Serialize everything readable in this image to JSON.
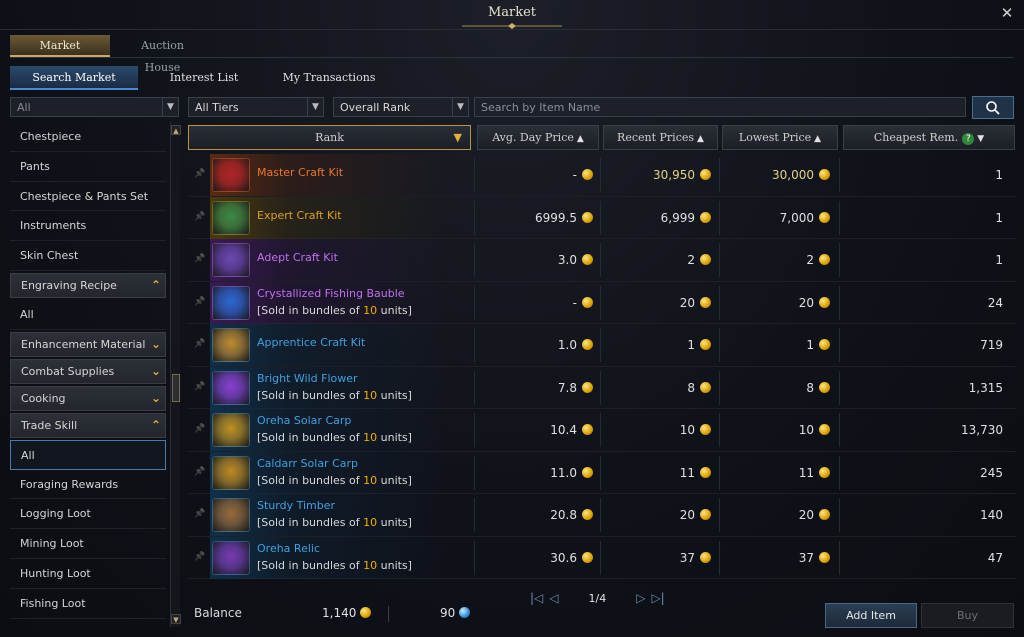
{
  "window": {
    "title": "Market"
  },
  "top_tabs": [
    "Market",
    "Auction House"
  ],
  "sub_tabs": [
    "Search Market",
    "Interest List",
    "My Transactions"
  ],
  "sidebar": {
    "filter_value": "All",
    "items": [
      {
        "label": "Chestpiece",
        "type": "item"
      },
      {
        "label": "Pants",
        "type": "item"
      },
      {
        "label": "Chestpiece & Pants Set",
        "type": "item"
      },
      {
        "label": "Instruments",
        "type": "item"
      },
      {
        "label": "Skin Chest",
        "type": "item"
      },
      {
        "label": "Engraving Recipe",
        "type": "cat-open"
      },
      {
        "label": "All",
        "type": "item"
      },
      {
        "label": "Enhancement Material",
        "type": "cat"
      },
      {
        "label": "Combat Supplies",
        "type": "cat"
      },
      {
        "label": "Cooking",
        "type": "cat"
      },
      {
        "label": "Trade Skill",
        "type": "cat-open"
      },
      {
        "label": "All",
        "type": "selected"
      },
      {
        "label": "Foraging Rewards",
        "type": "item"
      },
      {
        "label": "Logging Loot",
        "type": "item"
      },
      {
        "label": "Mining Loot",
        "type": "item"
      },
      {
        "label": "Hunting Loot",
        "type": "item"
      },
      {
        "label": "Fishing Loot",
        "type": "item"
      }
    ]
  },
  "filters": {
    "tier": "All Tiers",
    "rank": "Overall Rank",
    "search_placeholder": "Search by Item Name"
  },
  "columns": {
    "rank": "Rank",
    "avg": "Avg. Day Price",
    "recent": "Recent Prices",
    "lowest": "Lowest Price",
    "cheapest": "Cheapest Rem."
  },
  "items": [
    {
      "name": "Master Craft Kit",
      "name_color": "#e8762c",
      "tint": "#5a2a12",
      "bundle": null,
      "avg": "-",
      "recent": "30,950",
      "lowest": "30,000",
      "rem": "1",
      "gold": true,
      "icon_color": "#b0242a"
    },
    {
      "name": "Expert Craft Kit",
      "name_color": "#e0a020",
      "tint": "#4a3a10",
      "bundle": null,
      "avg": "6999.5",
      "recent": "6,999",
      "lowest": "7,000",
      "rem": "1",
      "gold": false,
      "icon_color": "#3a8a4a"
    },
    {
      "name": "Adept Craft Kit",
      "name_color": "#c070f0",
      "tint": "#3a1a52",
      "bundle": null,
      "avg": "3.0",
      "recent": "2",
      "lowest": "2",
      "rem": "1",
      "gold": false,
      "icon_color": "#6a4ab0"
    },
    {
      "name": "Crystallized Fishing Bauble",
      "name_color": "#c070f0",
      "tint": "#3a1a52",
      "bundle": "10",
      "avg": "-",
      "recent": "20",
      "lowest": "20",
      "rem": "24",
      "gold": false,
      "icon_color": "#2a6ad0"
    },
    {
      "name": "Apprentice Craft Kit",
      "name_color": "#3fa0e0",
      "tint": "#10304a",
      "bundle": null,
      "avg": "1.0",
      "recent": "1",
      "lowest": "1",
      "rem": "719",
      "gold": false,
      "icon_color": "#c08a30"
    },
    {
      "name": "Bright Wild Flower",
      "name_color": "#3fa0e0",
      "tint": "#10304a",
      "bundle": "10",
      "avg": "7.8",
      "recent": "8",
      "lowest": "8",
      "rem": "1,315",
      "gold": false,
      "icon_color": "#8a40d0"
    },
    {
      "name": "Oreha Solar Carp",
      "name_color": "#3fa0e0",
      "tint": "#10304a",
      "bundle": "10",
      "avg": "10.4",
      "recent": "10",
      "lowest": "10",
      "rem": "13,730",
      "gold": false,
      "icon_color": "#c09020"
    },
    {
      "name": "Caldarr Solar Carp",
      "name_color": "#3fa0e0",
      "tint": "#10304a",
      "bundle": "10",
      "avg": "11.0",
      "recent": "11",
      "lowest": "11",
      "rem": "245",
      "gold": false,
      "icon_color": "#c08a20"
    },
    {
      "name": "Sturdy Timber",
      "name_color": "#3fa0e0",
      "tint": "#10304a",
      "bundle": "10",
      "avg": "20.8",
      "recent": "20",
      "lowest": "20",
      "rem": "140",
      "gold": false,
      "icon_color": "#9a6a3a"
    },
    {
      "name": "Oreha Relic",
      "name_color": "#3fa0e0",
      "tint": "#10304a",
      "bundle": "10",
      "avg": "30.6",
      "recent": "37",
      "lowest": "37",
      "rem": "47",
      "gold": false,
      "icon_color": "#7a3ab0"
    }
  ],
  "bundle_text": {
    "prefix": "[Sold in bundles of ",
    "suffix": " units]"
  },
  "pager": {
    "page": "1/4"
  },
  "footer": {
    "balance_label": "Balance",
    "gold": "1,140",
    "blue": "90",
    "add_item": "Add Item",
    "buy": "Buy"
  }
}
